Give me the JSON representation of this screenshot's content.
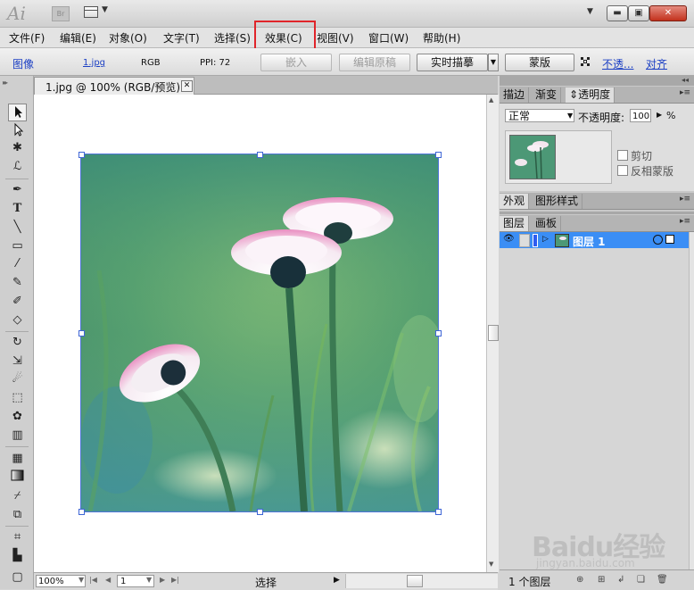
{
  "app": {
    "logo": "Ai",
    "bridge": "Br",
    "window_buttons": {
      "minimize": "▬",
      "maximize": "▣",
      "close": "✕"
    }
  },
  "menu": [
    {
      "label": "文件(F)",
      "highlighted": false
    },
    {
      "label": "编辑(E)",
      "highlighted": false
    },
    {
      "label": "对象(O)",
      "highlighted": false
    },
    {
      "label": "文字(T)",
      "highlighted": false
    },
    {
      "label": "选择(S)",
      "highlighted": false
    },
    {
      "label": "效果(C)",
      "highlighted": true
    },
    {
      "label": "视图(V)",
      "highlighted": false
    },
    {
      "label": "窗口(W)",
      "highlighted": false
    },
    {
      "label": "帮助(H)",
      "highlighted": false
    }
  ],
  "controlbar": {
    "object_type": "图像",
    "filename": "1.jpg",
    "color_mode": "RGB",
    "ppi": "PPI: 72",
    "embed": "嵌入",
    "edit_original": "编辑原稿",
    "live_trace": "实时描摹",
    "mask": "蒙版",
    "opacity_link": "不透...",
    "align_link": "对齐"
  },
  "document": {
    "tab_title": "1.jpg @ 100% (RGB/预览)",
    "close": "✕"
  },
  "statusbar": {
    "zoom": "100%",
    "page": "1",
    "status": "选择"
  },
  "panels": {
    "transparency": {
      "tabs": [
        "描边",
        "渐变",
        "透明度"
      ],
      "active_tab": "透明度",
      "blend_mode": "正常",
      "opacity_label": "不透明度:",
      "opacity_value": "100",
      "opacity_unit": "%",
      "clip_label": "剪切",
      "invert_mask_label": "反相蒙版"
    },
    "appearance": {
      "tabs": [
        "外观",
        "图形样式"
      ]
    },
    "layers": {
      "tabs": [
        "图层",
        "画板"
      ],
      "layer_name": "图层 1",
      "count": "1 个图层",
      "selection_color": "#3b8ef5"
    }
  },
  "watermark": {
    "brand": "Baidu经验",
    "url": "jingyan.baidu.com"
  },
  "icons": {
    "tools": [
      "selection-tool",
      "direct-selection-tool",
      "magic-wand-tool",
      "lasso-tool",
      "pen-tool",
      "type-tool",
      "line-tool",
      "rectangle-tool",
      "paintbrush-tool",
      "pencil-tool",
      "blob-brush-tool",
      "eraser-tool",
      "rotate-tool",
      "scale-tool",
      "warp-tool",
      "free-transform-tool",
      "symbol-sprayer-tool",
      "graph-tool",
      "mesh-tool",
      "gradient-tool",
      "eyedropper-tool",
      "blend-tool",
      "slice-tool",
      "column-graph-tool",
      "artboard-tool"
    ]
  }
}
